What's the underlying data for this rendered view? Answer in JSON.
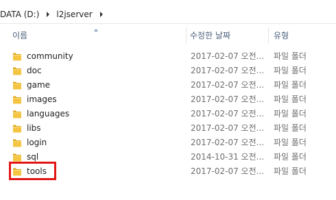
{
  "breadcrumb": {
    "items": [
      "DATA (D:)",
      "l2jserver"
    ]
  },
  "columns": {
    "name": "이름",
    "date_modified": "수정한 날짜",
    "type": "유형"
  },
  "files": [
    {
      "name": "community",
      "date": "2017-02-07 오전...",
      "type": "파일 폴더"
    },
    {
      "name": "doc",
      "date": "2017-02-07 오전...",
      "type": "파일 폴더"
    },
    {
      "name": "game",
      "date": "2017-02-07 오전...",
      "type": "파일 폴더"
    },
    {
      "name": "images",
      "date": "2017-02-07 오전...",
      "type": "파일 폴더"
    },
    {
      "name": "languages",
      "date": "2017-02-07 오전...",
      "type": "파일 폴더"
    },
    {
      "name": "libs",
      "date": "2017-02-07 오전...",
      "type": "파일 폴더"
    },
    {
      "name": "login",
      "date": "2017-02-07 오전...",
      "type": "파일 폴더"
    },
    {
      "name": "sql",
      "date": "2014-10-31 오전...",
      "type": "파일 폴더"
    },
    {
      "name": "tools",
      "date": "2017-02-07 오전...",
      "type": "파일 폴더"
    }
  ],
  "icons": {
    "folder": "folder-icon",
    "separator": "chevron-right-icon",
    "sort": "sort-ascending-icon"
  },
  "colors": {
    "folder_yellow": "#f4c542",
    "highlight": "#e31414"
  }
}
